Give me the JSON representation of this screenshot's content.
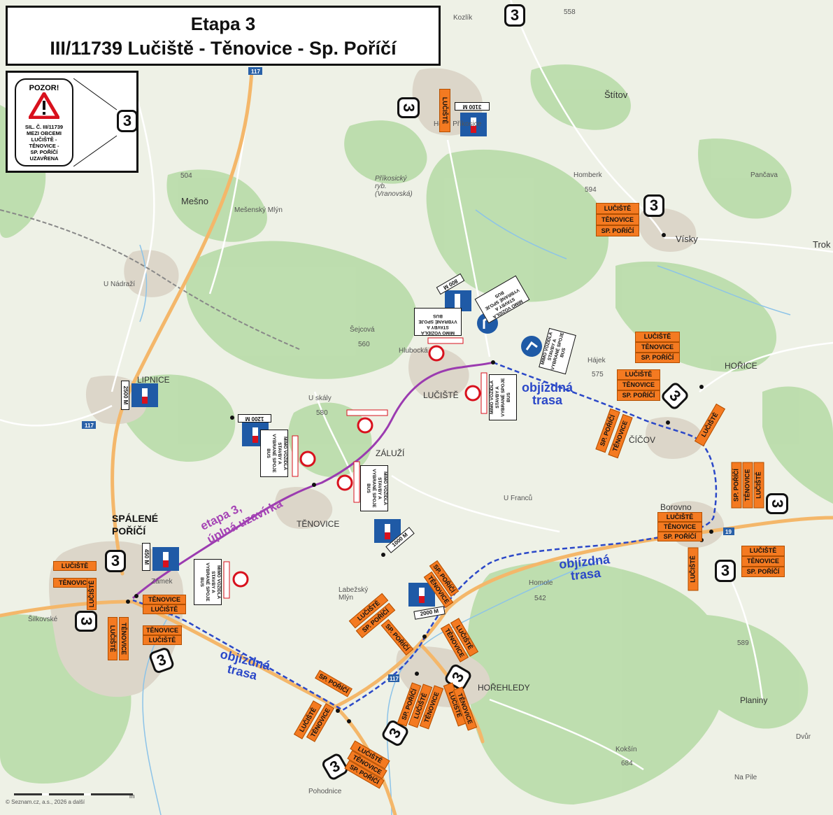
{
  "title": {
    "line1": "Etapa 3",
    "line2": "III/11739 Lučiště - Těnovice - Sp. Poříčí"
  },
  "legend": {
    "warning_heading": "POZOR!",
    "warning_text": [
      "SIL. Č. III/11739",
      "MEZI OBCEMI",
      "LUČIŠTĚ -",
      "TĚNOVICE -",
      "SP. POŘÍČÍ",
      "UZAVŘENA"
    ],
    "tag": "3"
  },
  "closure_label": [
    "etapa 3,",
    "úplná uzavírka"
  ],
  "detour_label": [
    "objízdná",
    "trasa"
  ],
  "colors": {
    "closure": "#9b3bb0",
    "detour": "#2b48c8",
    "plate": "#f47a21",
    "road": "#f3a64a",
    "forest": "#a9d39a"
  },
  "places": [
    {
      "id": "spalene",
      "text": "SPÁLENÉ"
    },
    {
      "id": "porici",
      "text": "POŘÍČÍ"
    },
    {
      "id": "tenovice",
      "text": "TĚNOVICE"
    },
    {
      "id": "luciste",
      "text": "LUČIŠTĚ"
    },
    {
      "id": "zaluzi",
      "text": "ZÁLUŽÍ"
    },
    {
      "id": "lipnice",
      "text": "LIPNICE"
    },
    {
      "id": "horice",
      "text": "HOŘICE"
    },
    {
      "id": "cicov",
      "text": "ČÍČOV"
    },
    {
      "id": "borovno",
      "text": "Borovno"
    },
    {
      "id": "horehledy",
      "text": "HOŘEHLEDY"
    },
    {
      "id": "mesno",
      "text": "Mešno"
    },
    {
      "id": "stitov",
      "text": "Štítov"
    },
    {
      "id": "visky",
      "text": "Vísky"
    },
    {
      "id": "planiny",
      "text": "Planiny"
    },
    {
      "id": "prikosice",
      "text": "Horní Příkosice"
    },
    {
      "id": "homberk",
      "text": "Homberk"
    },
    {
      "id": "pancava",
      "text": "Pančava"
    },
    {
      "id": "usk",
      "text": "U skály"
    },
    {
      "id": "sejcova",
      "text": "Šejcová"
    },
    {
      "id": "unadrazi",
      "text": "U Nádraží"
    },
    {
      "id": "ufrancilu",
      "text": "U Franců"
    },
    {
      "id": "homole",
      "text": "Homole"
    },
    {
      "id": "koksin",
      "text": "Kokšín"
    },
    {
      "id": "napile",
      "text": "Na Pile"
    },
    {
      "id": "pohodnice",
      "text": "Pohodnice"
    },
    {
      "id": "hajek",
      "text": "Hájek"
    },
    {
      "id": "hlubocka",
      "text": "Hlubocká"
    },
    {
      "id": "labezsky",
      "text": "Labežský Mlýn"
    },
    {
      "id": "mesensky",
      "text": "Mešenský Mlýn"
    },
    {
      "id": "dvur",
      "text": "Dvůr"
    },
    {
      "id": "troki",
      "text": "Trok"
    },
    {
      "id": "zamek",
      "text": "Zámek"
    },
    {
      "id": "silkovske",
      "text": "Šilkovské"
    },
    {
      "id": "kozlik",
      "text": "Kozlík"
    },
    {
      "id": "rybnik",
      "text": "Příkosický ryb. (Vranovská)"
    }
  ],
  "heights": [
    "504",
    "558",
    "594",
    "580",
    "560",
    "575",
    "542",
    "589",
    "684"
  ],
  "road_numbers": [
    "117",
    "117",
    "19",
    "117"
  ],
  "distance_signs": [
    "3100 M",
    "800 M",
    "2500 M",
    "1200 M",
    "1000 M",
    "450 M",
    "2000 M"
  ],
  "bus_sign": [
    "MIMO VOZIDLA",
    "STAVBY A",
    "VYBRANÉ SPOJE",
    "BUS"
  ],
  "plates": {
    "luciste": "LUČIŠTĚ",
    "tenovice": "TĚNOVICE",
    "sp_porici": "SP. POŘÍČÍ"
  },
  "copyright": "© Seznam.cz, a.s., 2026 a další",
  "scale_label": "m"
}
